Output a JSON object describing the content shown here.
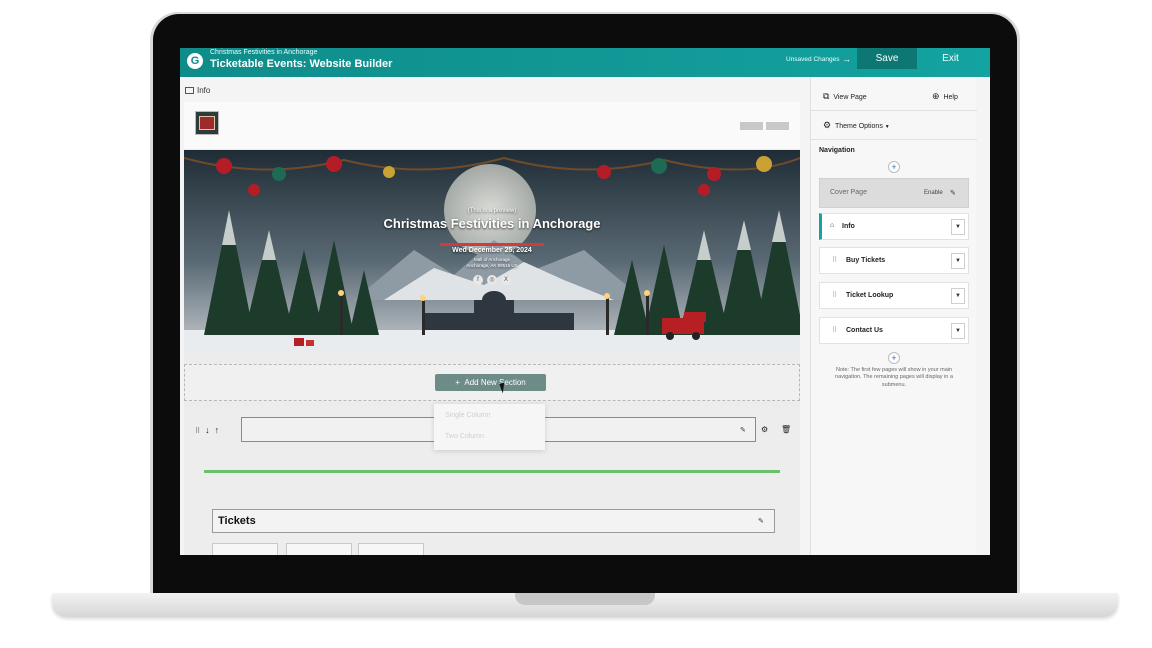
{
  "topbar": {
    "subtitle": "Christmas Festivities in Anchorage",
    "title": "Ticketable Events: Website Builder",
    "unsaved": "Unsaved Changes",
    "save_label": "Save",
    "exit_label": "Exit",
    "logo_letter": "G"
  },
  "editor": {
    "info_label": "Info",
    "banner": {
      "preview_note": "(This is a preview)",
      "title": "Christmas Festivities in Anchorage",
      "date": "Wed December 25, 2024",
      "location_line1": "Mall of Anchorage",
      "location_line2": "Anchorage, AK 99515 US"
    },
    "add_section_label": "Add New Section",
    "dropdown_options": [
      "Single Column",
      "Two Column"
    ],
    "tickets_label": "Tickets"
  },
  "panel": {
    "view_page": "View Page",
    "help": "Help",
    "theme_options": "Theme Options",
    "navigation_title": "Navigation",
    "cover_page": "Cover Page",
    "cover_enable": "Enable",
    "nav_items": [
      {
        "label": "Info"
      },
      {
        "label": "Buy Tickets"
      },
      {
        "label": "Ticket Lookup"
      },
      {
        "label": "Contact Us"
      }
    ],
    "note": "Note: The first few pages will show in your main navigation. The remaining pages will display in a submenu."
  },
  "colors": {
    "accent": "#13a3a0",
    "divider_green": "#6cbf6c"
  }
}
